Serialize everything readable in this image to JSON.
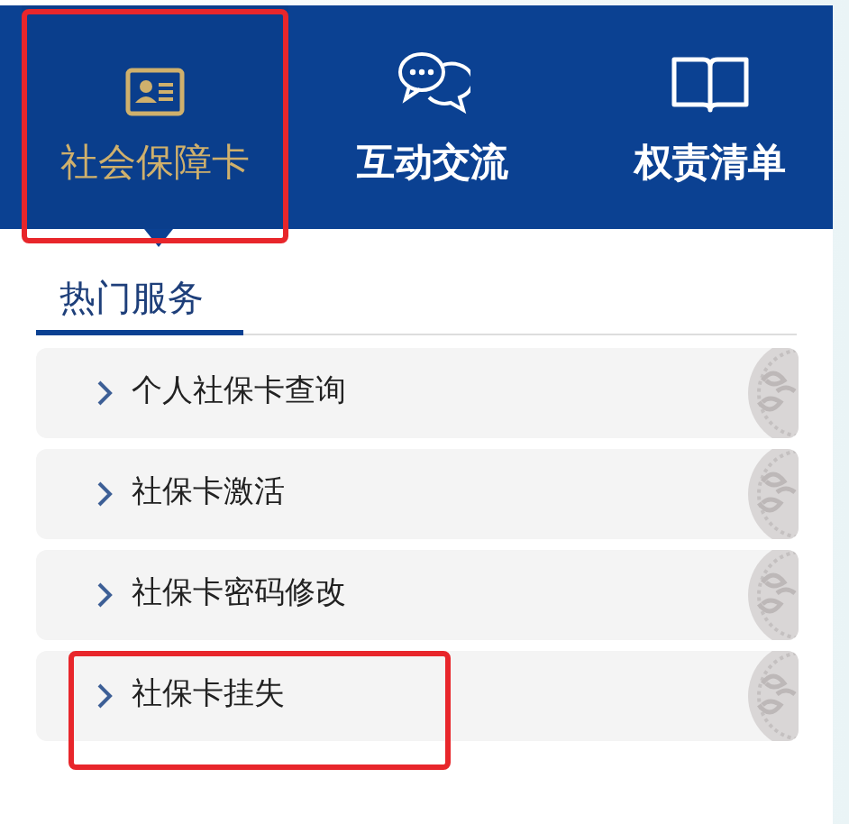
{
  "nav_tabs": [
    {
      "label": "社会保障卡",
      "selected": true,
      "highlighted": true
    },
    {
      "label": "互动交流",
      "selected": false,
      "highlighted": false
    },
    {
      "label": "权责清单",
      "selected": false,
      "highlighted": false
    }
  ],
  "section_tabs": [
    {
      "label": "热门服务",
      "selected": true
    }
  ],
  "services": [
    {
      "label": "个人社保卡查询",
      "highlighted": false
    },
    {
      "label": "社保卡激活",
      "highlighted": false
    },
    {
      "label": "社保卡密码修改",
      "highlighted": false
    },
    {
      "label": "社保卡挂失",
      "highlighted": true
    }
  ]
}
